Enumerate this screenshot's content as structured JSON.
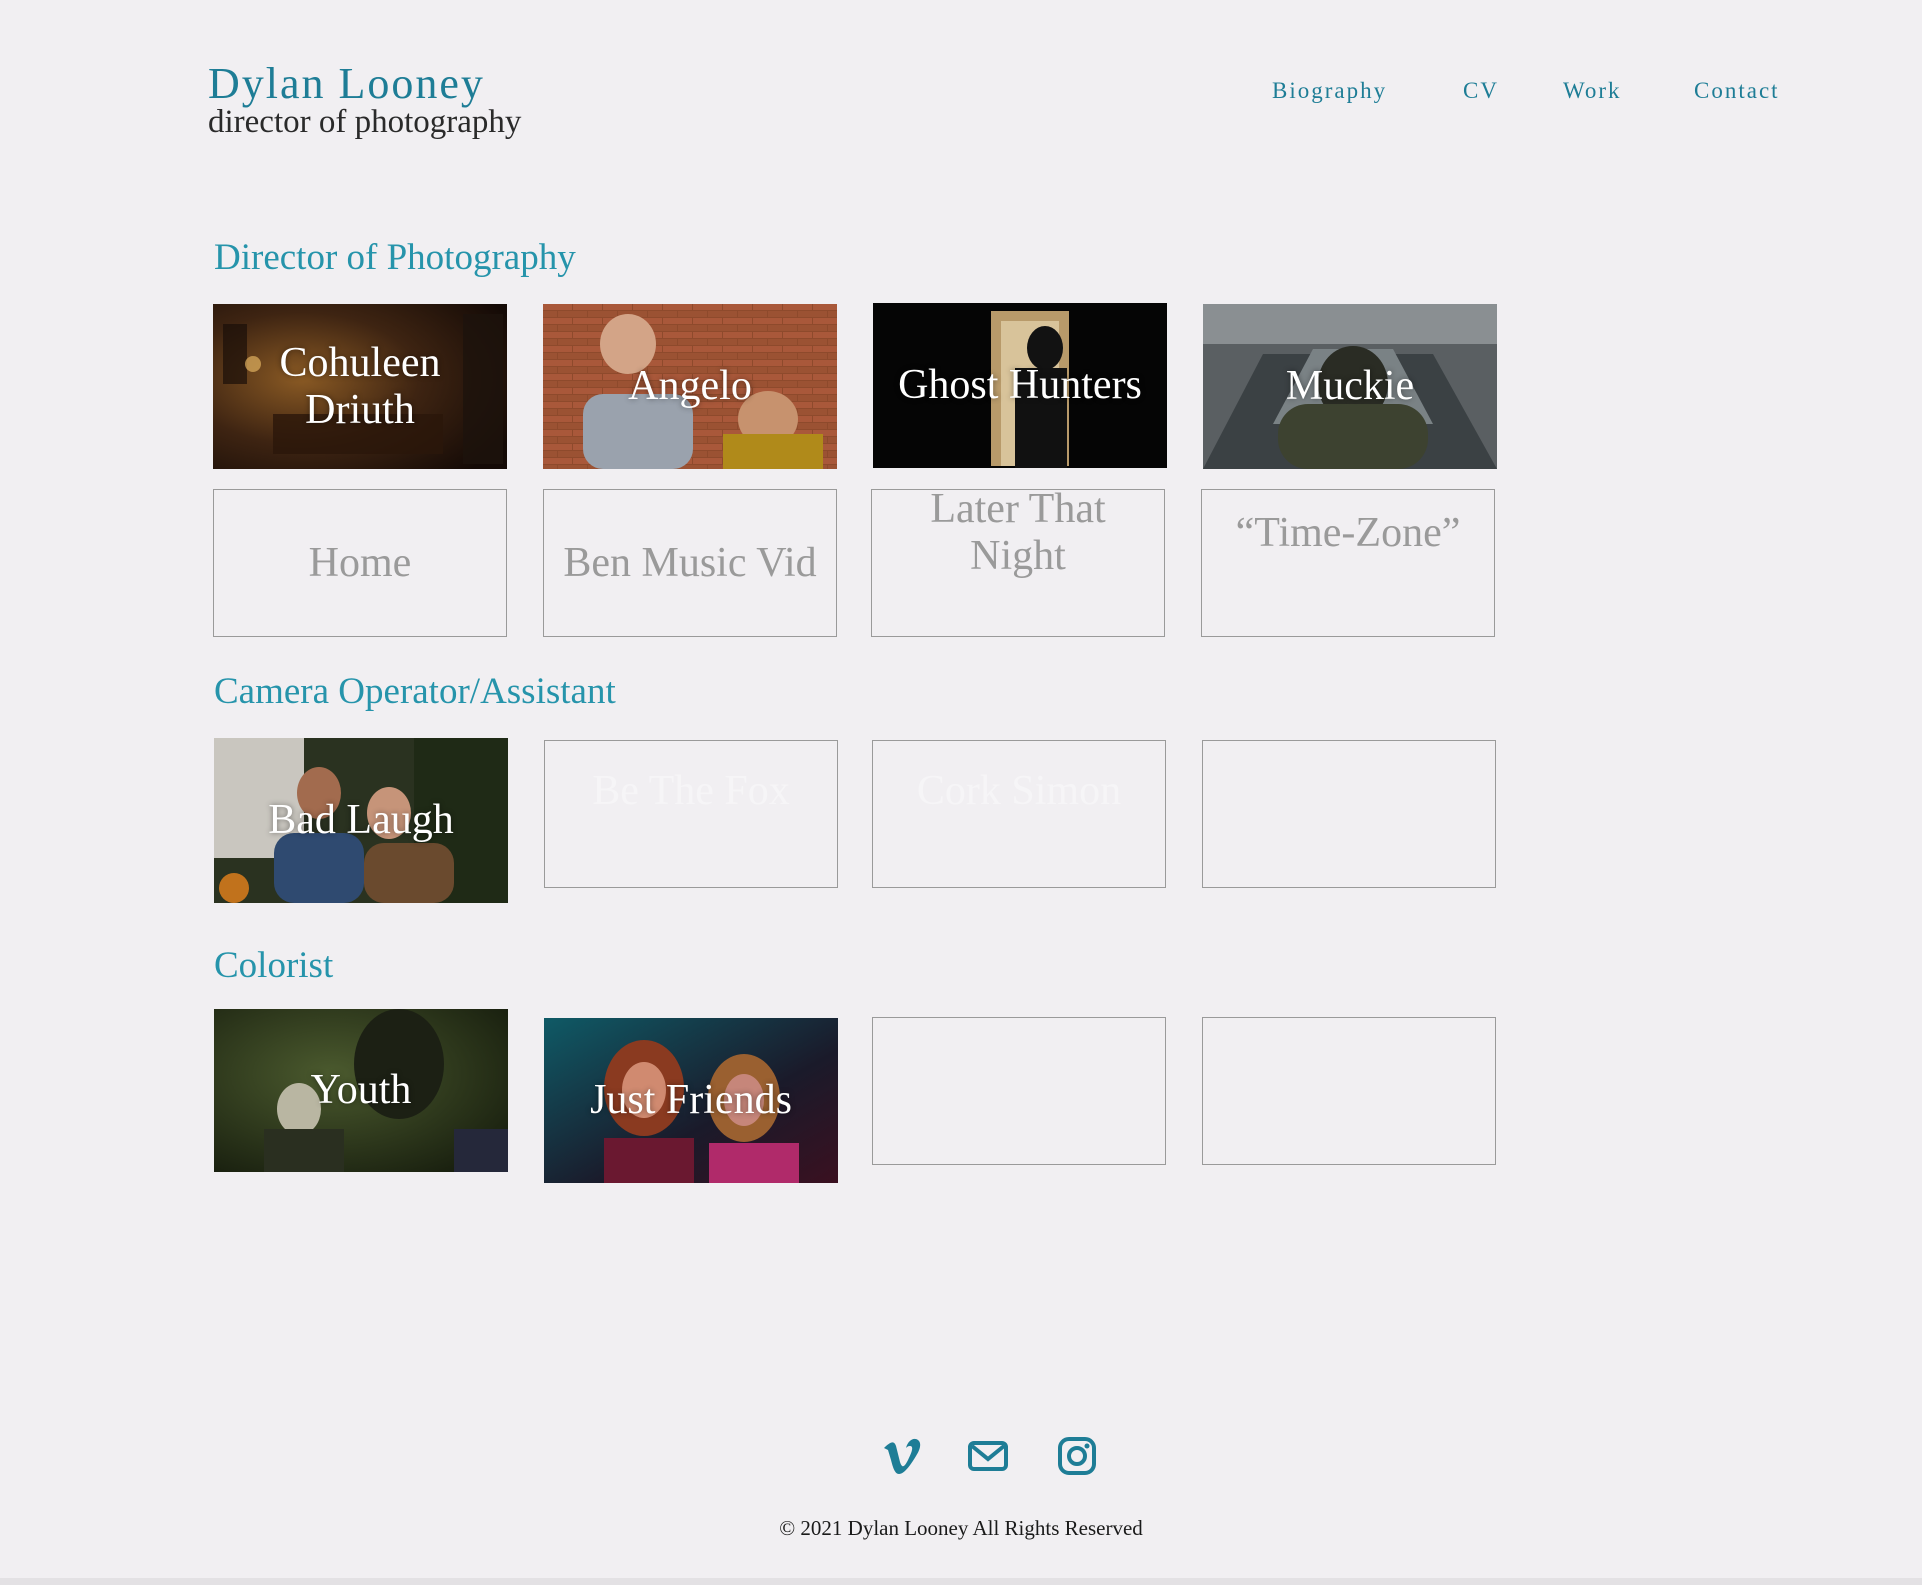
{
  "header": {
    "title": "Dylan Looney",
    "subtitle": "director of photography"
  },
  "nav": {
    "items": [
      "Biography",
      "CV",
      "Work",
      "Contact"
    ]
  },
  "sections": {
    "dop": {
      "title": "Director of Photography",
      "row1": [
        "Cohuleen Driuth",
        "Angelo",
        "Ghost Hunters",
        "Muckie"
      ],
      "row2": [
        "Home",
        "Ben Music Vid",
        "Later That Night",
        "“Time-Zone”"
      ]
    },
    "camera": {
      "title": "Camera Operator/Assistant",
      "tiles": [
        "Bad Laugh",
        "Be The Fox",
        "Cork Simon",
        ""
      ]
    },
    "colorist": {
      "title": "Colorist",
      "tiles": [
        "Youth",
        "Just Friends",
        "",
        ""
      ]
    }
  },
  "footer": {
    "icons": [
      "vimeo-icon",
      "mail-icon",
      "instagram-icon"
    ],
    "copyright": "© 2021 Dylan Looney All Rights Reserved"
  },
  "colors": {
    "accent": "#1e7d96",
    "section": "#2694ab",
    "background": "#f1eff2"
  }
}
